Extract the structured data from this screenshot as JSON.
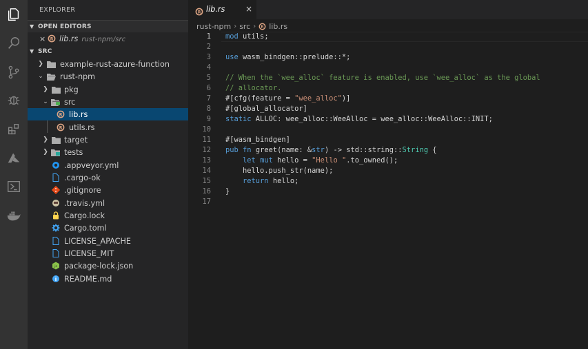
{
  "sidebar": {
    "title": "EXPLORER",
    "open_editors": {
      "header": "OPEN EDITORS",
      "items": [
        {
          "close": "×",
          "name": "lib.rs",
          "path": "rust-npm/src"
        }
      ]
    },
    "src_header": "SRC",
    "tree": [
      {
        "label": "example-rust-azure-function",
        "type": "folder",
        "state": "collapsed"
      },
      {
        "label": "rust-npm",
        "type": "folder",
        "state": "expanded"
      },
      {
        "label": "pkg",
        "type": "folder",
        "state": "collapsed"
      },
      {
        "label": "src",
        "type": "folder",
        "state": "expanded"
      },
      {
        "label": "lib.rs",
        "type": "rust-file",
        "selected": true
      },
      {
        "label": "utils.rs",
        "type": "rust-file"
      },
      {
        "label": "target",
        "type": "folder",
        "state": "collapsed"
      },
      {
        "label": "tests",
        "type": "folder",
        "state": "collapsed"
      },
      {
        "label": ".appveyor.yml",
        "type": "appveyor-file"
      },
      {
        "label": ".cargo-ok",
        "type": "file"
      },
      {
        "label": ".gitignore",
        "type": "git-file"
      },
      {
        "label": ".travis.yml",
        "type": "travis-file"
      },
      {
        "label": "Cargo.lock",
        "type": "lock-file"
      },
      {
        "label": "Cargo.toml",
        "type": "settings-file"
      },
      {
        "label": "LICENSE_APACHE",
        "type": "file"
      },
      {
        "label": "LICENSE_MIT",
        "type": "file"
      },
      {
        "label": "package-lock.json",
        "type": "node-file"
      },
      {
        "label": "README.md",
        "type": "info-file"
      }
    ]
  },
  "editor": {
    "tab": {
      "label": "lib.rs",
      "close": "×"
    },
    "breadcrumb": [
      "rust-npm",
      "src",
      "lib.rs"
    ],
    "breadcrumb_sep": "›",
    "line_numbers": [
      "1",
      "2",
      "3",
      "4",
      "5",
      "6",
      "7",
      "8",
      "9",
      "10",
      "11",
      "12",
      "13",
      "14",
      "15",
      "16",
      "17"
    ],
    "code_lines": [
      "mod utils;",
      "",
      "use wasm_bindgen::prelude::*;",
      "",
      "// When the `wee_alloc` feature is enabled, use `wee_alloc` as the global",
      "// allocator.",
      "#[cfg(feature = \"wee_alloc\")]",
      "#[global_allocator]",
      "static ALLOC: wee_alloc::WeeAlloc = wee_alloc::WeeAlloc::INIT;",
      "",
      "#[wasm_bindgen]",
      "pub fn greet(name: &str) -> std::string::String {",
      "    let mut hello = \"Hello \".to_owned();",
      "    hello.push_str(name);",
      "    return hello;",
      "}",
      ""
    ]
  },
  "colors": {
    "activity_bar": "#333333",
    "sidebar": "#252526",
    "editor": "#1e1e1e",
    "selection": "#094771",
    "keyword": "#569cd6",
    "string": "#ce9178",
    "comment": "#6a9955",
    "type": "#4ec9b0",
    "rust_icon": "#dea584"
  },
  "activity_icons": [
    "explorer-icon",
    "search-icon",
    "source-control-icon",
    "debug-icon",
    "extensions-icon",
    "azure-icon",
    "powershell-icon",
    "docker-icon"
  ]
}
